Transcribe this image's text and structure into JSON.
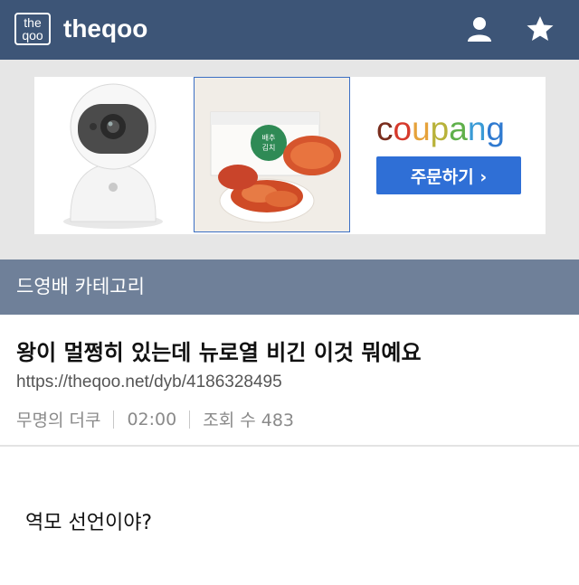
{
  "header": {
    "logo_top": "the",
    "logo_bottom": "qoo",
    "site_name": "theqoo",
    "icons": [
      "user-icon",
      "star-icon"
    ]
  },
  "ad": {
    "brand": "coupang",
    "button_label": "주문하기 ›",
    "food_package_text": "배추김치"
  },
  "category": {
    "label": "드영배 카테고리"
  },
  "post": {
    "title": "왕이 멀쩡히 있는데 뉴로열 비긴 이것 뭐예요",
    "url": "https://theqoo.net/dyb/4186328495",
    "author": "무명의 더쿠",
    "time": "02:00",
    "views_label": "조회 수 483",
    "body": "역모 선언이야?"
  },
  "colors": {
    "header_bg": "#3d5577",
    "category_bg": "#6f8099",
    "ad_bg": "#e6e6e6",
    "button_blue": "#2f6fd6"
  }
}
